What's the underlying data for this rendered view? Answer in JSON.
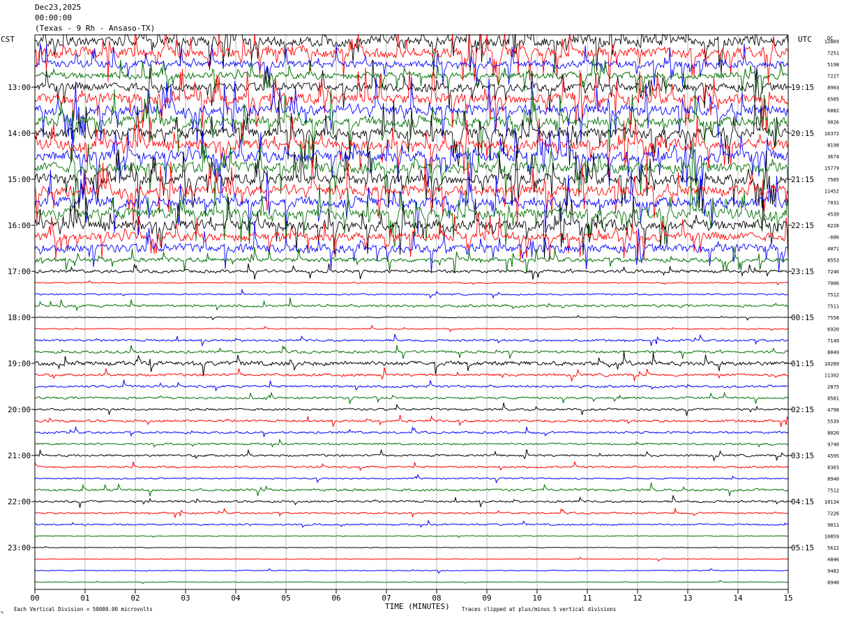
{
  "header": {
    "date": "Dec23,2025",
    "time": "00:00:00",
    "station": "(Texas - 9 Rh - Ansaso-TX)"
  },
  "tz_left": "CST",
  "tz_right": "UTC",
  "dc_label": "DC",
  "footer": {
    "scale": "Each Vertical Division = 50000.00 microvolts",
    "clip": "Traces clipped at plus/minus 5 vertical divisions",
    "corner": "↖"
  },
  "chart_data": {
    "type": "line",
    "xlabel": "TIME (MINUTES)",
    "x_ticks": [
      "00",
      "01",
      "02",
      "03",
      "04",
      "05",
      "06",
      "07",
      "08",
      "09",
      "10",
      "11",
      "12",
      "13",
      "14",
      "15"
    ],
    "xlim": [
      0,
      15
    ],
    "trace_colors": [
      "#000000",
      "#ff0000",
      "#0000ff",
      "#007000"
    ],
    "left_hour_labels": [
      "13:00",
      "14:00",
      "15:00",
      "16:00",
      "17:00",
      "18:00",
      "19:00",
      "20:00",
      "21:00",
      "22:00",
      "23:00"
    ],
    "right_hour_labels": [
      "19:15",
      "20:15",
      "21:15",
      "22:15",
      "23:15",
      "00:15",
      "01:15",
      "02:15",
      "03:15",
      "04:15",
      "05:15"
    ],
    "hour_label_first_trace": 4,
    "dc_offsets": [
      "12869",
      "7251",
      "5198",
      "7227",
      "8903",
      "6505",
      "6082",
      "9026",
      "16372",
      "8198",
      "3674",
      "15779",
      "7505",
      "11452",
      "7031",
      "4539",
      "8228",
      "-606",
      "4071",
      "8553",
      "7246",
      "7006",
      "7512",
      "7511",
      "7558",
      "6920",
      "7149",
      "8849",
      "10289",
      "11392",
      "2875",
      "8581",
      "4798",
      "5539",
      "8020",
      "9740",
      "4595",
      "8303",
      "8940",
      "7512",
      "10134",
      "7226",
      "9011",
      "10859",
      "5622",
      "4846",
      "9482",
      "8948"
    ],
    "trace_activity": [
      5,
      5,
      3.5,
      3,
      4,
      5,
      5,
      5,
      5,
      5,
      5,
      5,
      5,
      5,
      5,
      5,
      5,
      4,
      4,
      2,
      1.4,
      0.5,
      0.7,
      1.2,
      0.4,
      0.5,
      1.0,
      1.2,
      2.0,
      1.2,
      1.1,
      1.0,
      1.0,
      1.1,
      1.0,
      0.9,
      1.0,
      0.9,
      0.7,
      1.1,
      1.0,
      0.8,
      0.8,
      0.4,
      0.3,
      0.35,
      0.4,
      0.3
    ]
  }
}
